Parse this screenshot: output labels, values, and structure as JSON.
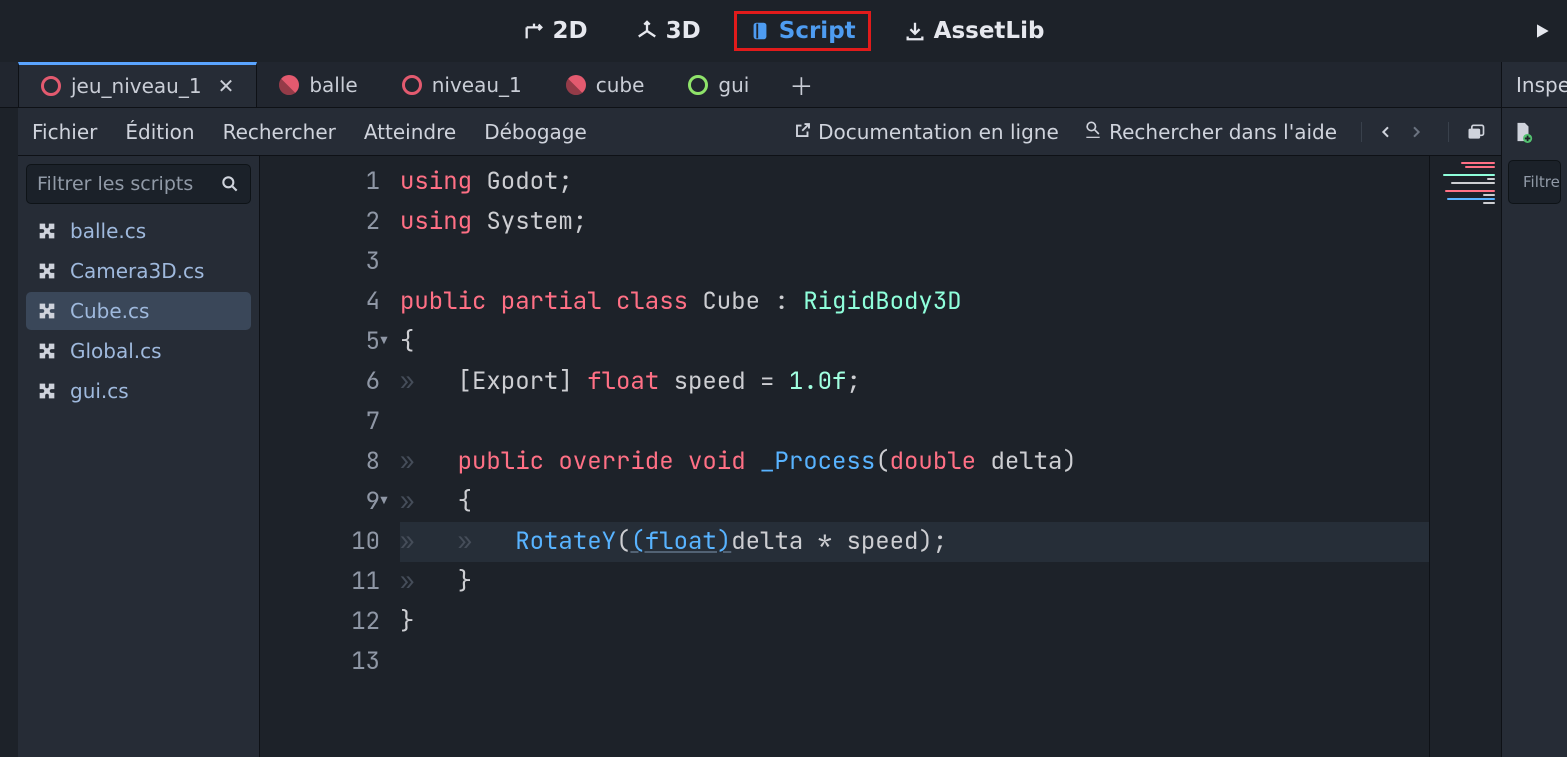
{
  "top": {
    "ws": [
      {
        "label": "2D"
      },
      {
        "label": "3D"
      },
      {
        "label": "Script"
      },
      {
        "label": "AssetLib"
      }
    ]
  },
  "tabs": [
    {
      "label": "jeu_niveau_1",
      "color": "#e35a6f"
    },
    {
      "label": "balle",
      "color": "#e35a6f"
    },
    {
      "label": "niveau_1",
      "color": "#e35a6f"
    },
    {
      "label": "cube",
      "color": "#e35a6f"
    },
    {
      "label": "gui",
      "color": "#8fe36a"
    }
  ],
  "menu": {
    "items": [
      "Fichier",
      "Édition",
      "Rechercher",
      "Atteindre",
      "Débogage"
    ],
    "doc": "Documentation en ligne",
    "help": "Rechercher dans l'aide"
  },
  "scripts": {
    "filter": "Filtrer les scripts",
    "list": [
      "balle.cs",
      "Camera3D.cs",
      "Cube.cs",
      "Global.cs",
      "gui.cs"
    ],
    "active": "Cube.cs"
  },
  "inspector": {
    "tab": "Inspe",
    "filter": "Filtre"
  },
  "code": {
    "lines": [
      [
        {
          "t": "using ",
          "c": "k-red"
        },
        {
          "t": "Godot;",
          "c": "k-def"
        }
      ],
      [
        {
          "t": "using ",
          "c": "k-red"
        },
        {
          "t": "System;",
          "c": "k-def"
        }
      ],
      [],
      [
        {
          "t": "public partial class ",
          "c": "k-red"
        },
        {
          "t": "Cube : ",
          "c": "k-def"
        },
        {
          "t": "RigidBody3D",
          "c": "k-typ"
        }
      ],
      [
        {
          "t": "{",
          "c": "k-def"
        }
      ],
      [
        {
          "t": "    [Export] ",
          "c": "k-attr"
        },
        {
          "t": "float ",
          "c": "k-red"
        },
        {
          "t": "speed = ",
          "c": "k-def"
        },
        {
          "t": "1.0f",
          "c": "k-num"
        },
        {
          "t": ";",
          "c": "k-def"
        }
      ],
      [],
      [
        {
          "t": "    ",
          "c": "k-def"
        },
        {
          "t": "public override void ",
          "c": "k-red"
        },
        {
          "t": "_Process",
          "c": "k-fn"
        },
        {
          "t": "(",
          "c": "k-def"
        },
        {
          "t": "double ",
          "c": "k-red"
        },
        {
          "t": "delta)",
          "c": "k-def"
        }
      ],
      [
        {
          "t": "    {",
          "c": "k-def"
        }
      ],
      [
        {
          "t": "        ",
          "c": "k-def"
        },
        {
          "t": "RotateY",
          "c": "k-fn"
        },
        {
          "t": "(",
          "c": "k-def"
        },
        {
          "t": "(float)",
          "c": "k-cast"
        },
        {
          "t": "delta * speed);",
          "c": "k-def"
        }
      ],
      [
        {
          "t": "    }",
          "c": "k-def"
        }
      ],
      [
        {
          "t": "}",
          "c": "k-def"
        }
      ],
      []
    ],
    "fold": {
      "5": "▾",
      "9": "▾"
    }
  }
}
